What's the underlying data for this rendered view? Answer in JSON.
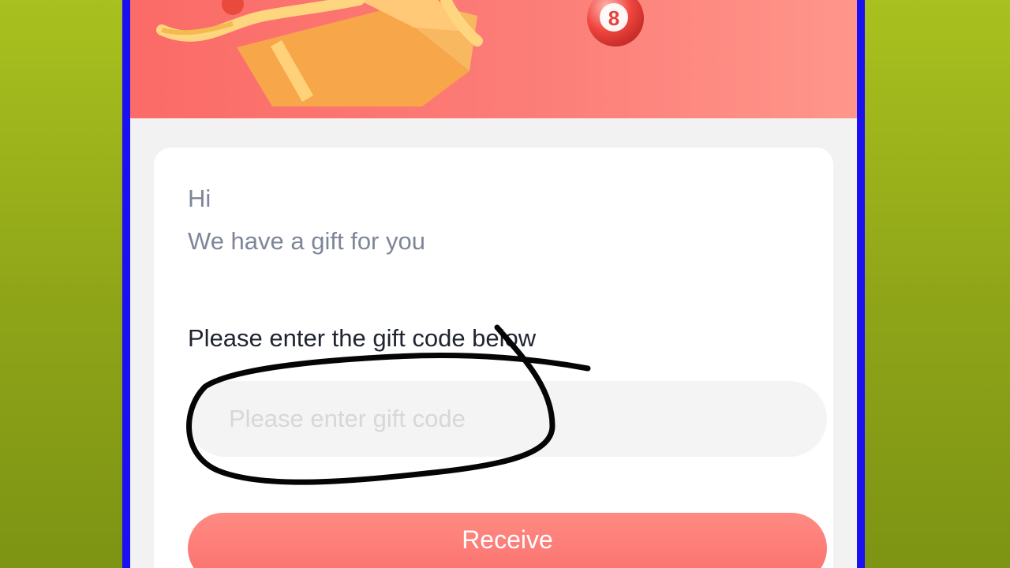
{
  "card": {
    "greeting": "Hi",
    "message": "We have a gift for you",
    "prompt": "Please enter the gift code below",
    "input_placeholder": "Please enter gift code",
    "input_value": "",
    "button_label": "Receive"
  },
  "banner": {
    "ball_number": "8",
    "gradient_start": "#fb6b67",
    "gradient_end": "#ff968b"
  },
  "colors": {
    "background": "#9ab41c",
    "frame": "#1a10f0",
    "button": "#fb706d",
    "annotation": "#000000"
  }
}
